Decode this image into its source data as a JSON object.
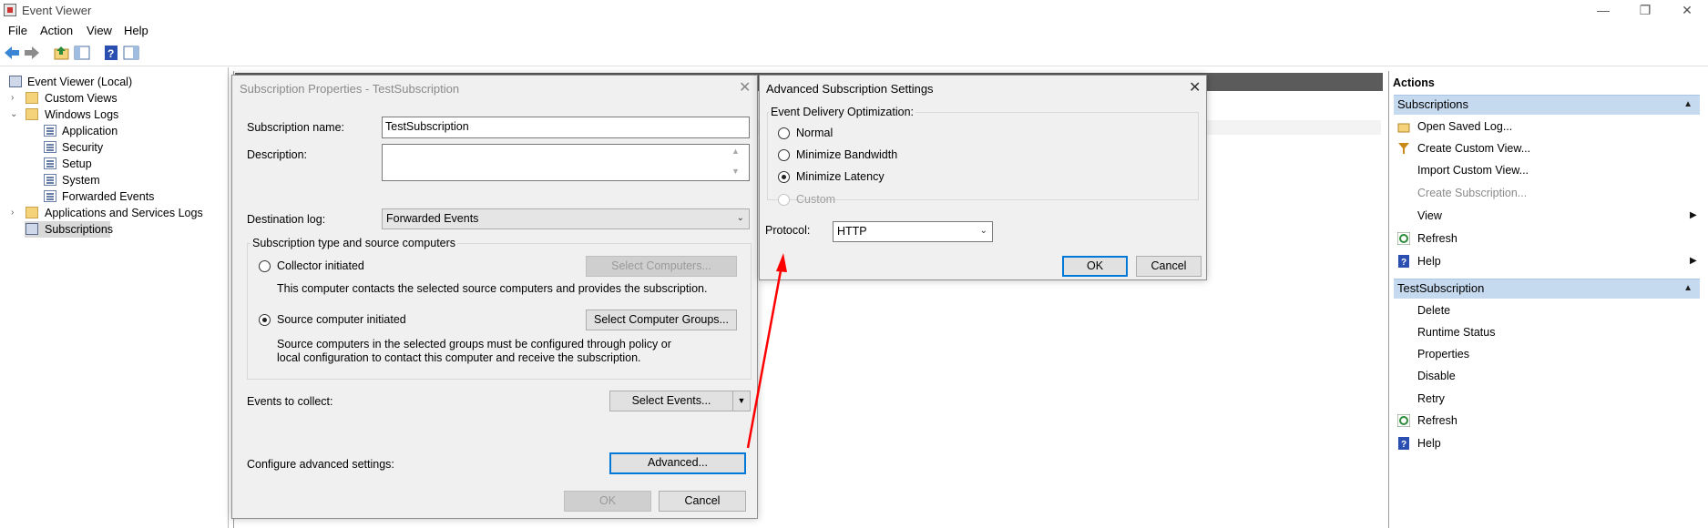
{
  "window": {
    "title": "Event Viewer",
    "minimize": "—",
    "restore": "❐",
    "close": "✕"
  },
  "menu": [
    "File",
    "Action",
    "View",
    "Help"
  ],
  "tree": {
    "root": "Event Viewer (Local)",
    "custom_views": "Custom Views",
    "windows_logs": "Windows Logs",
    "windows_logs_items": [
      "Application",
      "Security",
      "Setup",
      "System",
      "Forwarded Events"
    ],
    "apps_services": "Applications and Services Logs",
    "subscriptions": "Subscriptions"
  },
  "subscription_dialog": {
    "title": "Subscription Properties - TestSubscription",
    "name_label": "Subscription name:",
    "name_value": "TestSubscription",
    "description_label": "Description:",
    "description_value": "",
    "destination_label": "Destination log:",
    "destination_value": "Forwarded Events",
    "type_group": "Subscription type and source computers",
    "collector_label": "Collector initiated",
    "collector_desc": "This computer contacts the selected source computers and provides the subscription.",
    "select_computers": "Select Computers...",
    "source_label": "Source computer initiated",
    "select_groups": "Select Computer Groups...",
    "source_desc_1": "Source computers in the selected groups must be configured through policy or",
    "source_desc_2": "local configuration to contact this computer and receive the subscription.",
    "events_label": "Events to collect:",
    "select_events": "Select Events...",
    "advanced_label": "Configure advanced settings:",
    "advanced_button": "Advanced...",
    "ok": "OK",
    "cancel": "Cancel"
  },
  "advanced_dialog": {
    "title": "Advanced Subscription Settings",
    "group": "Event Delivery Optimization:",
    "options": [
      "Normal",
      "Minimize Bandwidth",
      "Minimize Latency",
      "Custom"
    ],
    "selected": "Minimize Latency",
    "protocol_label": "Protocol:",
    "protocol_value": "HTTP",
    "ok": "OK",
    "cancel": "Cancel"
  },
  "actions": {
    "title": "Actions",
    "section1": "Subscriptions",
    "section1_items": [
      "Open Saved Log...",
      "Create Custom View...",
      "Import Custom View...",
      "Create Subscription...",
      "View",
      "Refresh",
      "Help"
    ],
    "section2": "TestSubscription",
    "section2_items": [
      "Delete",
      "Runtime Status",
      "Properties",
      "Disable",
      "Retry",
      "Refresh",
      "Help"
    ]
  },
  "colors": {
    "accent": "#0078d7",
    "section_header": "#c5d9ef",
    "annotation_arrow": "#ff0000"
  }
}
